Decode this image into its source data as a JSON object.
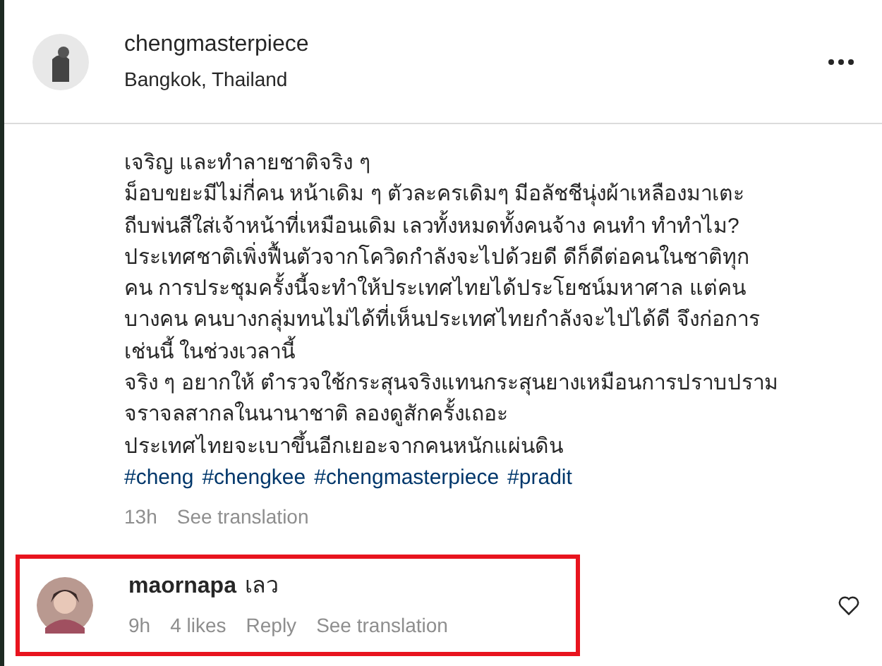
{
  "post": {
    "username": "chengmasterpiece",
    "location": "Bangkok, Thailand",
    "caption_lines": [
      "เจริญ และทำลายชาติจริง ๆ",
      "ม็อบขยะมีไม่กี่คน หน้าเดิม ๆ ตัวละครเดิมๆ มีอลัชชีนุ่งผ้าเหลืองมาเตะ",
      "ถีบพ่นสีใส่เจ้าหน้าที่เหมือนเดิม เลวทั้งหมดทั้งคนจ้าง คนทำ ทำทำไม?",
      "ประเทศชาติเพิ่งฟื้นตัวจากโควิดกำลังจะไปด้วยดี ดีก็ดีต่อคนในชาติทุก",
      "คน การประชุมครั้งนี้จะทำให้ประเทศไทยได้ประโยชน์มหาศาล แต่คน",
      "บางคน คนบางกลุ่มทนไม่ได้ที่เห็นประเทศไทยกำลังจะไปได้ดี จึงก่อการ",
      "เช่นนี้ ในช่วงเวลานี้",
      "จริง ๆ อยากให้ ตำรวจใช้กระสุนจริงแทนกระสุนยางเหมือนการปราบปราม",
      "จราจลสากลในนานาชาติ ลองดูสักครั้งเถอะ",
      "ประเทศไทยจะเบาขึ้นอีกเยอะจากคนหนักแผ่นดิน"
    ],
    "hashtags": [
      "#cheng",
      "#chengkee",
      "#chengmasterpiece",
      "#pradit"
    ],
    "time": "13h",
    "see_translation": "See translation"
  },
  "comment": {
    "username": "maornapa",
    "text": "เลว",
    "time": "9h",
    "likes": "4 likes",
    "reply": "Reply",
    "see_translation": "See translation",
    "highlighted": true
  }
}
